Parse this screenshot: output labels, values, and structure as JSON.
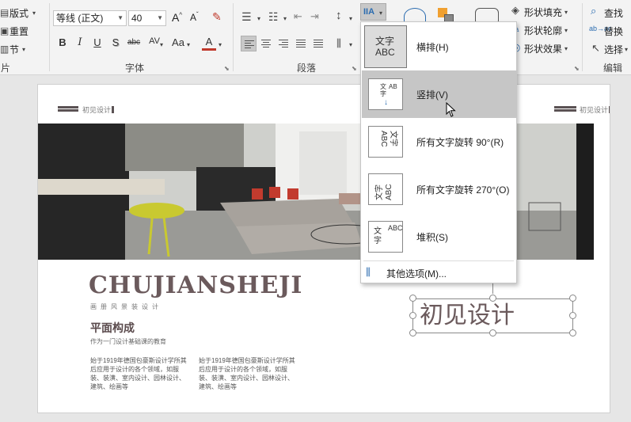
{
  "ribbon": {
    "slides_group": {
      "layout": "版式",
      "reset": "重置",
      "section": "节",
      "label": "片"
    },
    "font_group": {
      "font_name": "等线 (正文)",
      "font_size": "40",
      "grow_icon": "A^",
      "shrink_icon": "Aˇ",
      "clear_format_icon": "eraser-icon",
      "bold": "B",
      "italic": "I",
      "underline": "U",
      "shadow": "S",
      "strikethrough": "abc",
      "char_spacing": "AV",
      "change_case": "Aa",
      "font_color": "A",
      "label": "字体"
    },
    "paragraph_group": {
      "label": "段落",
      "text_direction_icon": "IIA"
    },
    "drawing_group": {
      "shape_fill": "形状填充",
      "shape_outline": "形状轮廓",
      "shape_effects": "形状效果"
    },
    "editing_group": {
      "find": "查找",
      "replace": "替换",
      "select": "选择",
      "label": "编辑"
    }
  },
  "slide": {
    "tag_left": "初见设计",
    "tag_right": "初见设计",
    "brand": "CHUJIANSHEJI",
    "brand_sub": "画册风景装设计",
    "heading": "平面构成",
    "caption": "作为一门设计基础课的教育",
    "para_left": "始于1919年德国包豪斯设计学所其后应用于设计的各个领域，如服装、装潢、室内设计、园林设计、建筑、绘画等",
    "para_right": "始于1919年德国包豪斯设计学所其后应用于设计的各个领域，如服装、装潢、室内设计、园林设计、建筑、绘画等",
    "textbox_text": "初见设计"
  },
  "menu": {
    "items": [
      {
        "label": "横排(H)",
        "icon_text": "文字\nABC",
        "icon": "horizontal-text-icon"
      },
      {
        "label": "竖排(V)",
        "icon_text": "竖排",
        "icon": "vertical-text-icon"
      },
      {
        "label": "所有文字旋转 90°(R)",
        "icon_text": "文字 ABC",
        "icon": "rotate-90-icon"
      },
      {
        "label": "所有文字旋转 270°(O)",
        "icon_text": "文字 ABC",
        "icon": "rotate-270-icon"
      },
      {
        "label": "堆积(S)",
        "icon_text": "文字 ABC",
        "icon": "stacked-text-icon"
      }
    ],
    "more": "其他选项(M)...",
    "highlighted_index": 1
  },
  "colors": {
    "accent": "#2b6cb0",
    "brand_text": "#6b5a5c",
    "menu_highlight": "#c6c6c6"
  }
}
